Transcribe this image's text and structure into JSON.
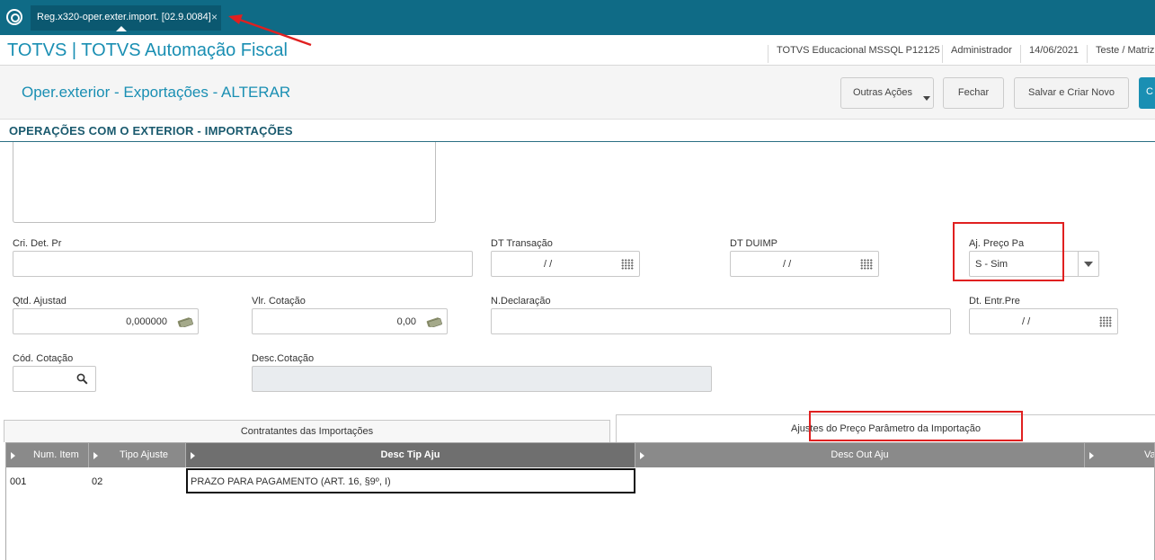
{
  "topbar": {
    "tab_label": "Reg.x320-oper.exter.import. [02.9.0084]",
    "tab_close": "×"
  },
  "appbar": {
    "title": "TOTVS | TOTVS Automação Fiscal",
    "environment": "TOTVS Educacional MSSQL P12125",
    "user": "Administrador",
    "date": "14/06/2021",
    "branch": "Teste / Matriz"
  },
  "header": {
    "title": "Oper.exterior - Exportações - ALTERAR",
    "actions": {
      "outras_acoes": "Outras Ações",
      "fechar": "Fechar",
      "salvar_criar": "Salvar e Criar Novo",
      "confirmar": "C"
    }
  },
  "section": {
    "title": "OPERAÇÕES COM O EXTERIOR - IMPORTAÇÕES"
  },
  "form": {
    "cri_det_pr": {
      "label": "Cri. Det. Pr",
      "value": ""
    },
    "dt_transacao": {
      "label": "DT Transação",
      "value": "/ /"
    },
    "dt_duimp": {
      "label": "DT DUIMP",
      "value": "/ /"
    },
    "aj_preco_pa": {
      "label": "Aj. Preço Pa",
      "value": "S - Sim"
    },
    "qtd_ajustad": {
      "label": "Qtd. Ajustad",
      "value": "0,000000"
    },
    "vlr_cotacao": {
      "label": "Vlr. Cotação",
      "value": "0,00"
    },
    "n_declaracao": {
      "label": "N.Declaração",
      "value": ""
    },
    "dt_entr_pre": {
      "label": "Dt. Entr.Pre",
      "value": "/ /"
    },
    "cod_cotacao": {
      "label": "Cód. Cotação",
      "value": ""
    },
    "desc_cotacao": {
      "label": "Desc.Cotação",
      "value": ""
    }
  },
  "tabs": [
    {
      "label": "Contratantes das Importações"
    },
    {
      "label": "Ajustes do Preço Parâmetro da Importação"
    }
  ],
  "grid": {
    "columns": [
      "Num. Item",
      "Tipo Ajuste",
      "Desc Tip Aju",
      "Desc Out Aju",
      "Val"
    ],
    "rows": [
      {
        "num_item": "001",
        "tipo_ajuste": "02",
        "desc_tip_aju": "PRAZO PARA PAGAMENTO (ART. 16, §9º, I)",
        "desc_out_aju": ""
      }
    ]
  },
  "colors": {
    "topbar": "#0f6b86",
    "accent": "#1a8fb3",
    "annotation": "#e02020"
  },
  "icons": [
    "app-menu-icon",
    "calendar-icon",
    "money-icon",
    "search-icon",
    "chevron-down-icon"
  ]
}
